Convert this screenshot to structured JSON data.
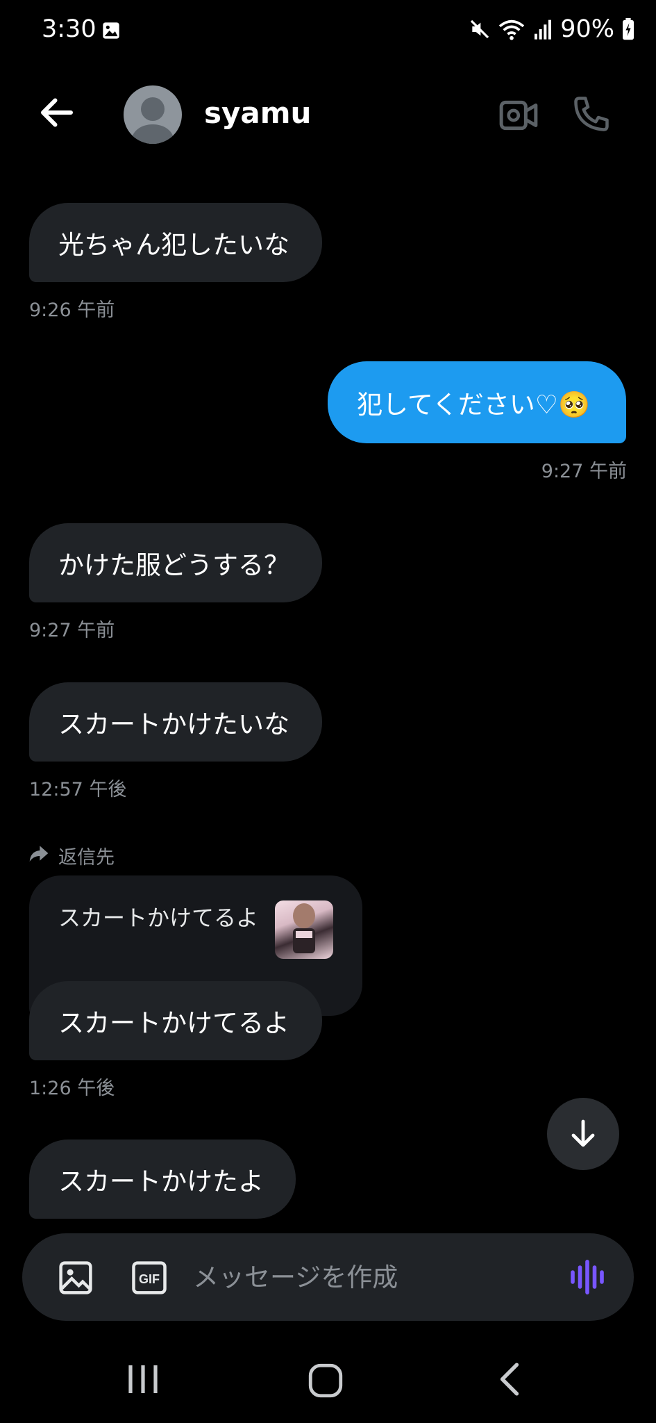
{
  "status_bar": {
    "time": "3:30",
    "battery": "90%",
    "icons": [
      "gallery-icon",
      "mute-icon",
      "wifi-icon",
      "signal-icon",
      "battery-icon"
    ]
  },
  "header": {
    "username": "syamu",
    "icons": [
      "back-arrow-icon",
      "video-call-icon",
      "phone-icon"
    ]
  },
  "messages": [
    {
      "text": "光ちゃん犯したいな",
      "time": "9:26 午前",
      "direction": "received"
    },
    {
      "text": "犯してください♡🥺",
      "time": "9:27 午前",
      "direction": "sent"
    },
    {
      "text": "かけた服どうする？",
      "time": "9:27 午前",
      "direction": "received"
    },
    {
      "text": "スカートかけたいな",
      "time": "12:57 午後",
      "direction": "received"
    },
    {
      "text": "スカートかけてるよ",
      "time": "1:26 午後",
      "direction": "received"
    },
    {
      "text": "スカートかけたよ",
      "time": "",
      "direction": "received"
    }
  ],
  "reply": {
    "label": "返信先",
    "quoted_text": "スカートかけてるよ"
  },
  "composer": {
    "placeholder": "メッセージを作成",
    "gif_label": "GIF"
  },
  "colors": {
    "background": "#000000",
    "received_bubble": "#202327",
    "sent_bubble": "#1d9bf0",
    "timestamp": "#8b9096",
    "voice_accent": "#7856ff"
  }
}
